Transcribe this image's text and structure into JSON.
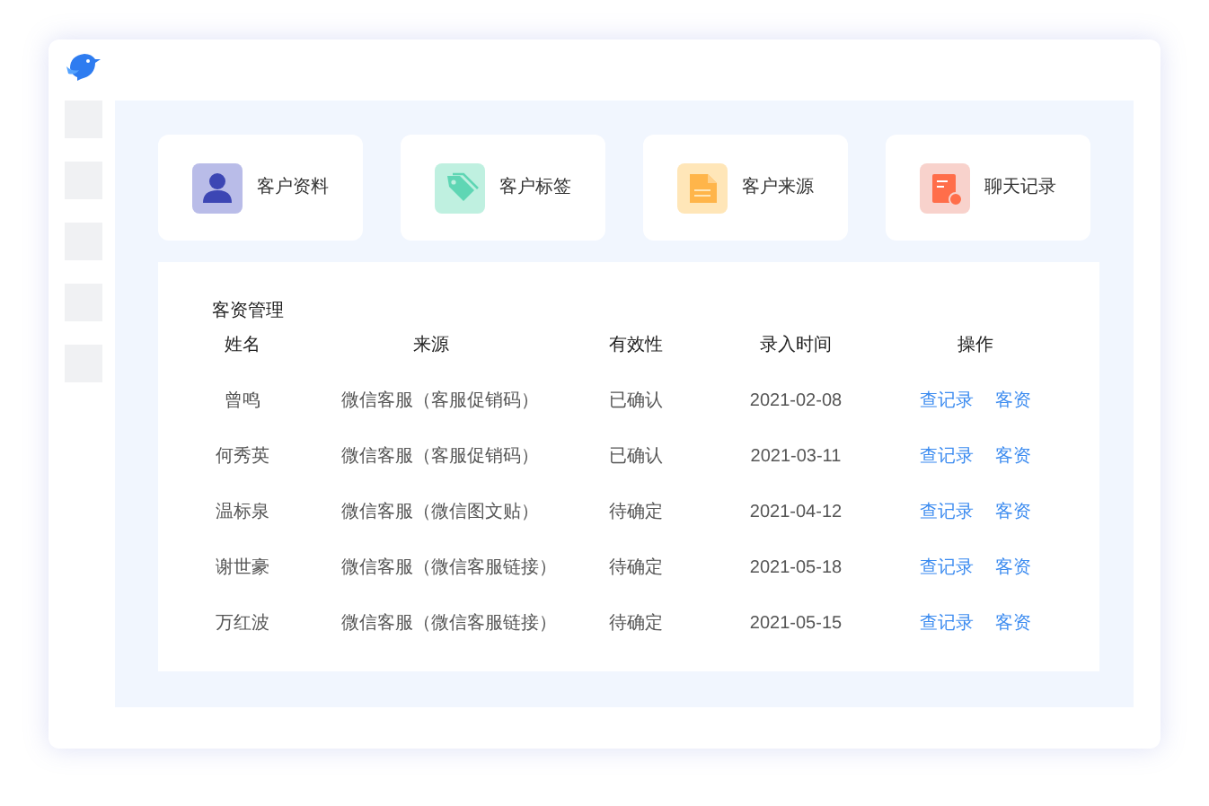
{
  "cards": [
    {
      "kind": "person",
      "label": "客户资料"
    },
    {
      "kind": "tag",
      "label": "客户标签"
    },
    {
      "kind": "document",
      "label": "客户来源"
    },
    {
      "kind": "record",
      "label": "聊天记录"
    }
  ],
  "table": {
    "title": "客资管理",
    "columns": [
      "姓名",
      "来源",
      "有效性",
      "录入时间",
      "操作"
    ],
    "rows": [
      {
        "name": "曾鸣",
        "source": "微信客服（客服促销码）",
        "validity": "已确认",
        "date": "2021-02-08",
        "actions": [
          "查记录",
          "客资"
        ]
      },
      {
        "name": "何秀英",
        "source": "微信客服（客服促销码）",
        "validity": "已确认",
        "date": "2021-03-11",
        "actions": [
          "查记录",
          "客资"
        ]
      },
      {
        "name": "温标泉",
        "source": "微信客服（微信图文贴）",
        "validity": "待确定",
        "date": "2021-04-12",
        "actions": [
          "查记录",
          "客资"
        ]
      },
      {
        "name": "谢世豪",
        "source": "微信客服（微信客服链接）",
        "validity": "待确定",
        "date": "2021-05-18",
        "actions": [
          "查记录",
          "客资"
        ]
      },
      {
        "name": "万红波",
        "source": "微信客服（微信客服链接）",
        "validity": "待确定",
        "date": "2021-05-15",
        "actions": [
          "查记录",
          "客资"
        ]
      }
    ]
  }
}
